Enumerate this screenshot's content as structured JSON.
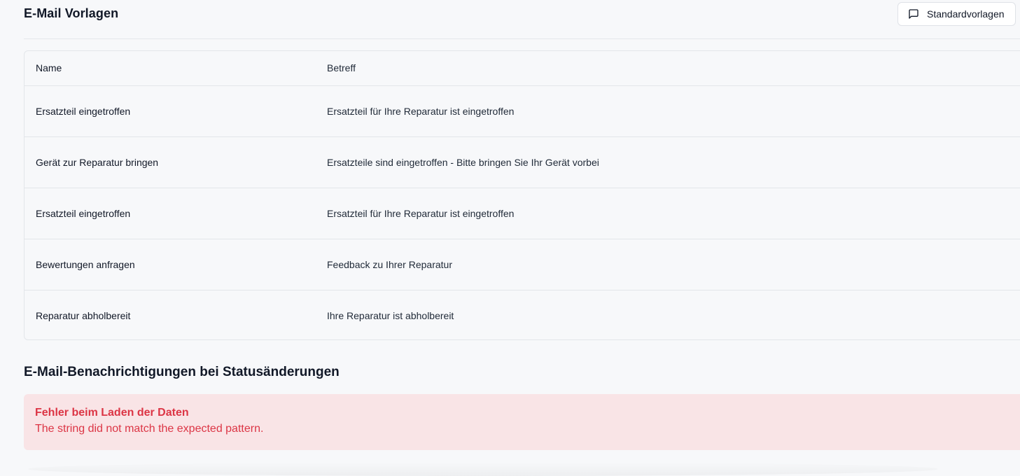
{
  "header": {
    "title": "E-Mail Vorlagen",
    "standard_button_label": "Standardvorlagen",
    "standard_button_icon": "message-square-icon"
  },
  "table": {
    "columns": [
      "Name",
      "Betreff"
    ],
    "rows": [
      {
        "name": "Ersatzteil eingetroffen",
        "subject": "Ersatzteil für Ihre Reparatur ist eingetroffen"
      },
      {
        "name": "Gerät zur Reparatur bringen",
        "subject": "Ersatzteile sind eingetroffen - Bitte bringen Sie Ihr Gerät vorbei"
      },
      {
        "name": "Ersatzteil eingetroffen",
        "subject": "Ersatzteil für Ihre Reparatur ist eingetroffen"
      },
      {
        "name": "Bewertungen anfragen",
        "subject": "Feedback zu Ihrer Reparatur"
      },
      {
        "name": "Reparatur abholbereit",
        "subject": "Ihre Reparatur ist abholbereit"
      }
    ]
  },
  "notifications": {
    "title": "E-Mail-Benachrichtigungen bei Statusänderungen",
    "error_title": "Fehler beim Laden der Daten",
    "error_message": "The string did not match the expected pattern.",
    "error_color": "#dc3545",
    "error_background": "#f9e4e6"
  }
}
